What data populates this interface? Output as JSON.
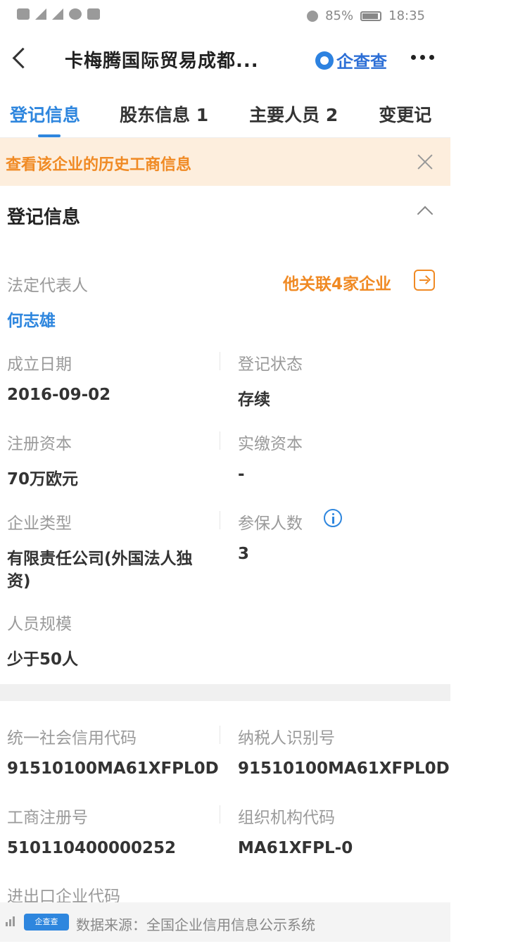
{
  "status_bar": {
    "battery": "85%",
    "time": "18:35"
  },
  "nav": {
    "title": "卡梅腾国际贸易成都...",
    "brand": "企查查"
  },
  "tabs": [
    {
      "label": "登记信息"
    },
    {
      "label": "股东信息 1"
    },
    {
      "label": "主要人员 2"
    },
    {
      "label": "变更记"
    }
  ],
  "banner": {
    "text": "查看该企业的历史工商信息"
  },
  "section": {
    "title": "登记信息"
  },
  "legal_rep": {
    "label": "法定代表人",
    "value": "何志雄",
    "related": "他关联4家企业"
  },
  "fields": {
    "established_date": {
      "label": "成立日期",
      "value": "2016-09-02"
    },
    "reg_status": {
      "label": "登记状态",
      "value": "存续"
    },
    "reg_capital": {
      "label": "注册资本",
      "value": "70万欧元"
    },
    "paid_capital": {
      "label": "实缴资本",
      "value": "-"
    },
    "company_type": {
      "label": "企业类型",
      "value_line1": "有限责任公司(外国法人独",
      "value_line2": "资)"
    },
    "insured_count": {
      "label": "参保人数",
      "value": "3"
    },
    "staff_size": {
      "label": "人员规模",
      "value": "少于50人"
    },
    "credit_code": {
      "label": "统一社会信用代码",
      "value": "91510100MA61XFPL0D"
    },
    "taxpayer_id": {
      "label": "纳税人识别号",
      "value": "91510100MA61XFPL0D"
    },
    "biz_reg_no": {
      "label": "工商注册号",
      "value": "510110400000252"
    },
    "org_code": {
      "label": "组织机构代码",
      "value": "MA61XFPL-0"
    },
    "import_export_code": {
      "label": "进出口企业代码"
    }
  },
  "footer": {
    "logo": "企查查",
    "text": "数据来源：全国企业信用信息公示系统"
  }
}
